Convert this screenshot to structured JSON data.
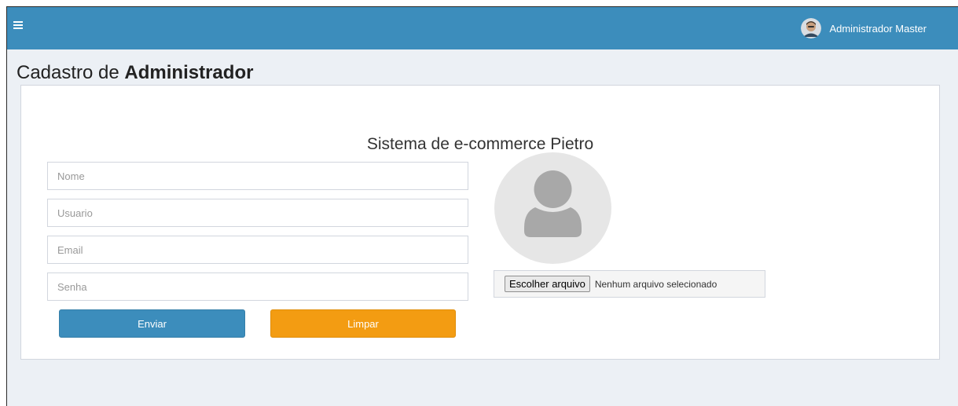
{
  "navbar": {
    "menu_icon": "hamburger-menu-icon",
    "user_name": "Administrador Master",
    "accent_color": "#3c8dbc"
  },
  "page": {
    "header_prefix": "Cadastro de ",
    "header_bold": "Administrador"
  },
  "form": {
    "system_title": "Sistema de e-commerce Pietro",
    "fields": {
      "nome_placeholder": "Nome",
      "usuario_placeholder": "Usuario",
      "email_placeholder": "Email",
      "senha_placeholder": "Senha"
    },
    "buttons": {
      "enviar": "Enviar",
      "limpar": "Limpar"
    },
    "button_colors": {
      "enviar": "#3c8dbc",
      "limpar": "#f39c12"
    }
  },
  "upload": {
    "avatar_icon": "user-silhouette-icon",
    "choose_file_label": "Escolher arquivo",
    "file_status": "Nenhum arquivo selecionado"
  }
}
